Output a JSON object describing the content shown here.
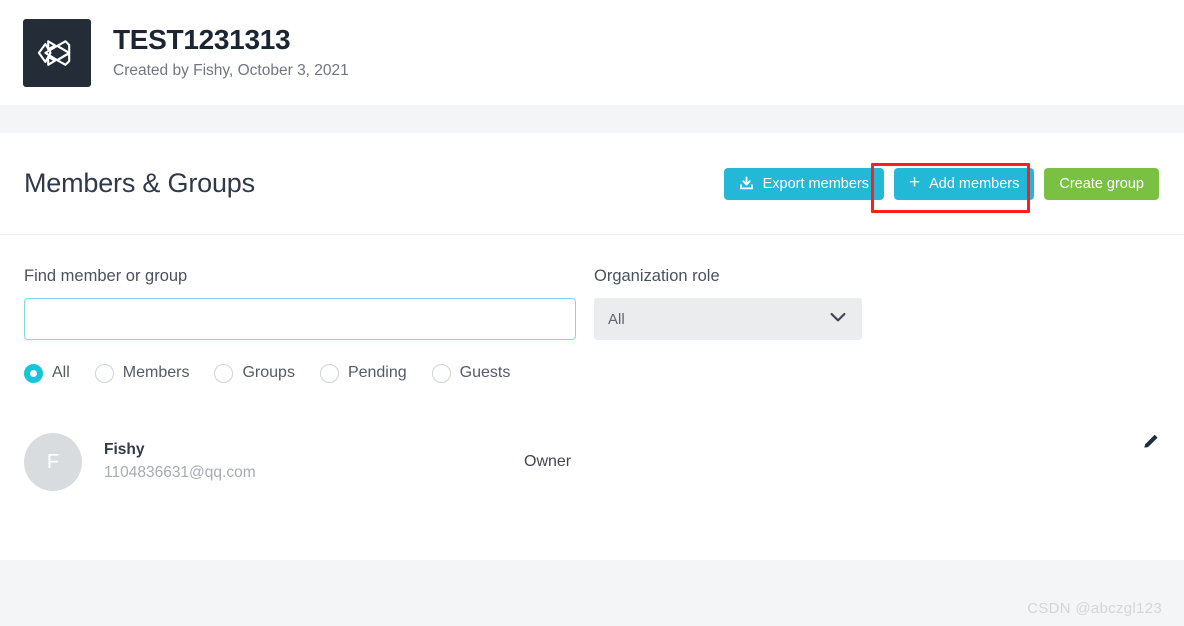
{
  "project": {
    "logo_icon": "unity-logo-icon",
    "title": "TEST1231313",
    "subtitle": "Created by Fishy, October 3, 2021"
  },
  "section": {
    "title": "Members & Groups",
    "actions": {
      "export_label": "Export members",
      "export_icon": "download-icon",
      "add_label": "Add members",
      "add_icon": "plus-icon",
      "create_group_label": "Create group"
    }
  },
  "filters": {
    "search_label": "Find member or group",
    "search_value": "",
    "search_placeholder": "",
    "role_label": "Organization role",
    "role_selected": "All",
    "role_options": [
      "All"
    ],
    "role_icon": "chevron-down-icon",
    "radios": [
      {
        "label": "All",
        "checked": true
      },
      {
        "label": "Members",
        "checked": false
      },
      {
        "label": "Groups",
        "checked": false
      },
      {
        "label": "Pending",
        "checked": false
      },
      {
        "label": "Guests",
        "checked": false
      }
    ]
  },
  "members": [
    {
      "avatar_initial": "F",
      "name": "Fishy",
      "email": "1104836631@qq.com",
      "role": "Owner",
      "edit_icon": "pencil-icon"
    }
  ],
  "annotation": {
    "type": "highlight-rectangle",
    "color": "#fc1f21",
    "target": "add-members-button"
  },
  "watermark": {
    "text": "CSDN @abczgl123"
  },
  "colors": {
    "accent_cyan": "#22b8d6",
    "accent_green": "#7ac143",
    "page_background": "#f4f5f7",
    "logo_background": "#232c37",
    "annotation_red": "#fc1f21"
  }
}
